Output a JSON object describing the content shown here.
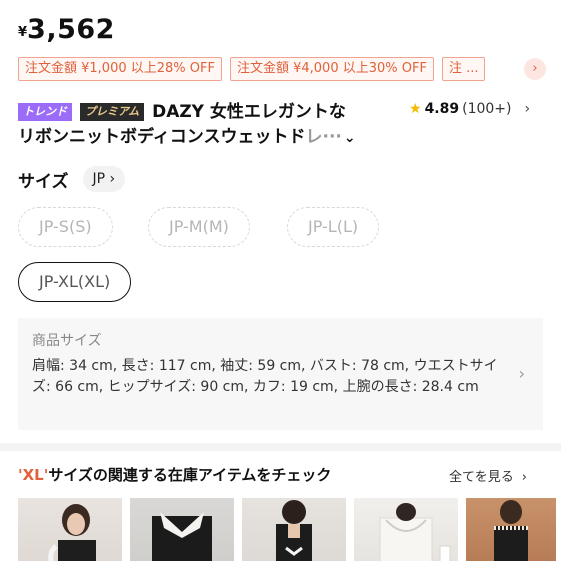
{
  "price": {
    "currency": "¥",
    "amount": "3,562"
  },
  "coupons": [
    "注文金額 ¥1,000 以上28% OFF",
    "注文金額 ¥4,000 以上30% OFF",
    "注 ..."
  ],
  "product": {
    "badge_trend": "トレンド",
    "badge_premium": "プレミアム",
    "title_line1": "DAZY 女性エレガントな",
    "title_line2": "リボンニットボディコンスウェットド",
    "title_line2_fade": "レ···",
    "expand_icon": "chevron-down-icon"
  },
  "rating": {
    "score": "4.89",
    "count": "(100+)"
  },
  "size": {
    "label": "サイズ",
    "region": "JP",
    "options": [
      "JP-S(S)",
      "JP-M(M)",
      "JP-L(L)",
      "JP-XL(XL)"
    ],
    "selected": "JP-XL(XL)"
  },
  "spec": {
    "title": "商品サイズ",
    "text": "肩幅: 34 cm, 長さ: 117 cm, 袖丈: 59 cm, バスト: 78 cm, ウエストサイズ: 66 cm, ヒップサイズ: 90 cm, カフ: 19 cm, 上腕の長さ: 28.4 cm"
  },
  "related": {
    "title_highlight": "'XL'",
    "title_rest": "サイズの関連する在庫アイテムをチェック",
    "see_all": "全てを見る"
  },
  "colors": {
    "accent": "#e0613c",
    "trend_badge": "#9b6cf7",
    "premium_badge": "#2a2a2a",
    "star": "#f5b800"
  }
}
